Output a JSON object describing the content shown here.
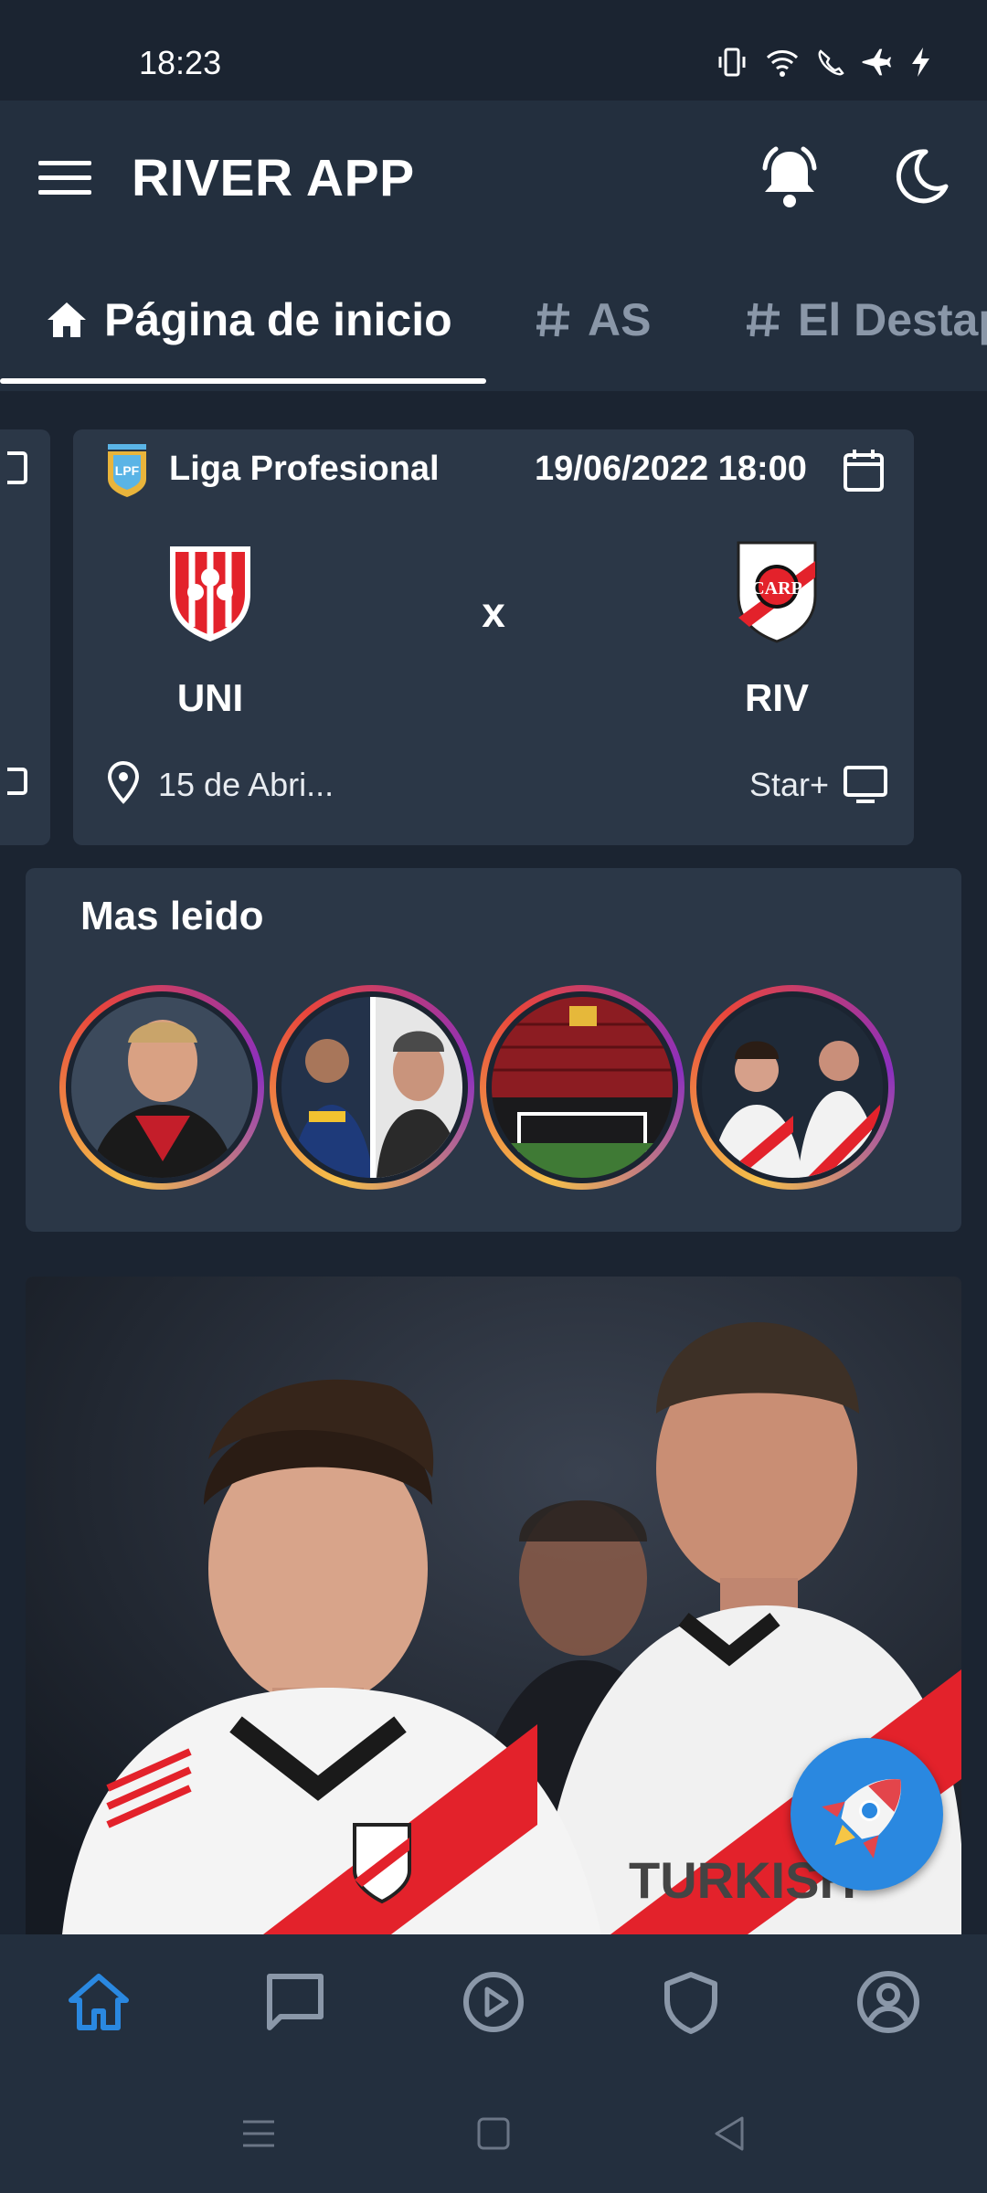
{
  "status_bar": {
    "time": "18:23"
  },
  "app_bar": {
    "title": "RIVER APP"
  },
  "tabs": [
    {
      "label": "Página de inicio",
      "icon": "home-icon",
      "selected": true
    },
    {
      "label": "AS",
      "icon": "hashtag-icon",
      "selected": false
    },
    {
      "label": "El Destap",
      "icon": "hashtag-icon",
      "selected": false
    }
  ],
  "match": {
    "league": "Liga Profesional",
    "date": "19/06/2022 18:00",
    "home": "UNI",
    "away": "RIV",
    "separator": "x",
    "venue": "15 de Abri...",
    "broadcaster": "Star+"
  },
  "most_read": {
    "title": "Mas leido",
    "stories": [
      "player-celebrating",
      "split-portrait",
      "empty-stadium",
      "river-players"
    ]
  },
  "bottom_nav": [
    "home-icon",
    "chat-icon",
    "play-icon",
    "shield-icon",
    "account-icon"
  ],
  "colors": {
    "accent": "#2a88e0",
    "background": "#1b2431",
    "card": "#2b3747",
    "river_red": "#e3222b"
  }
}
